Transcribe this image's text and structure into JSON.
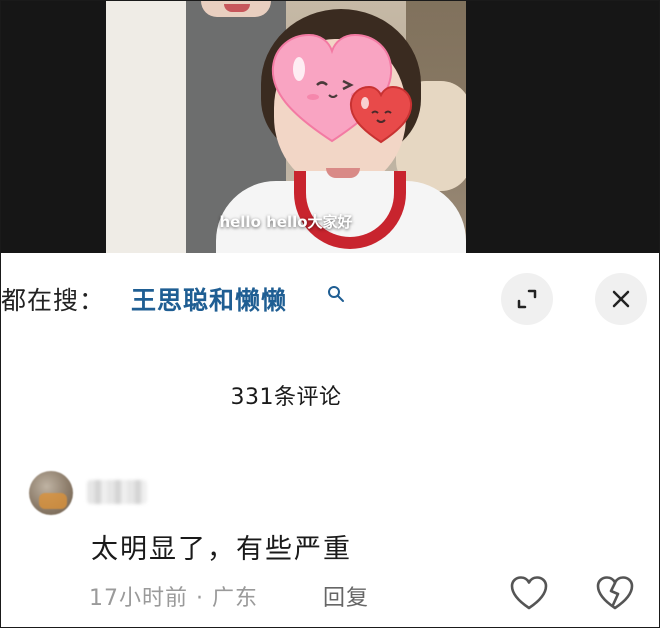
{
  "video": {
    "caption": "hello hello大家好",
    "colors": {
      "heart_pink": "#f9a4c2",
      "heart_red": "#e84a4a",
      "collar_red": "#c8242e"
    }
  },
  "search": {
    "prefix": "都在搜：",
    "keyword": "王思聪和懒懒",
    "icon": "search-icon",
    "keyword_color": "#1f5e93"
  },
  "header_buttons": {
    "expand_icon": "expand-icon",
    "close_icon": "close-icon"
  },
  "comments": {
    "count_label": "331条评论",
    "items": [
      {
        "text": "太明显了，有些严重",
        "meta": "17小时前 · 广东",
        "reply_label": "回复",
        "like_icon": "heart-outline-icon",
        "dislike_icon": "broken-heart-icon"
      }
    ]
  }
}
